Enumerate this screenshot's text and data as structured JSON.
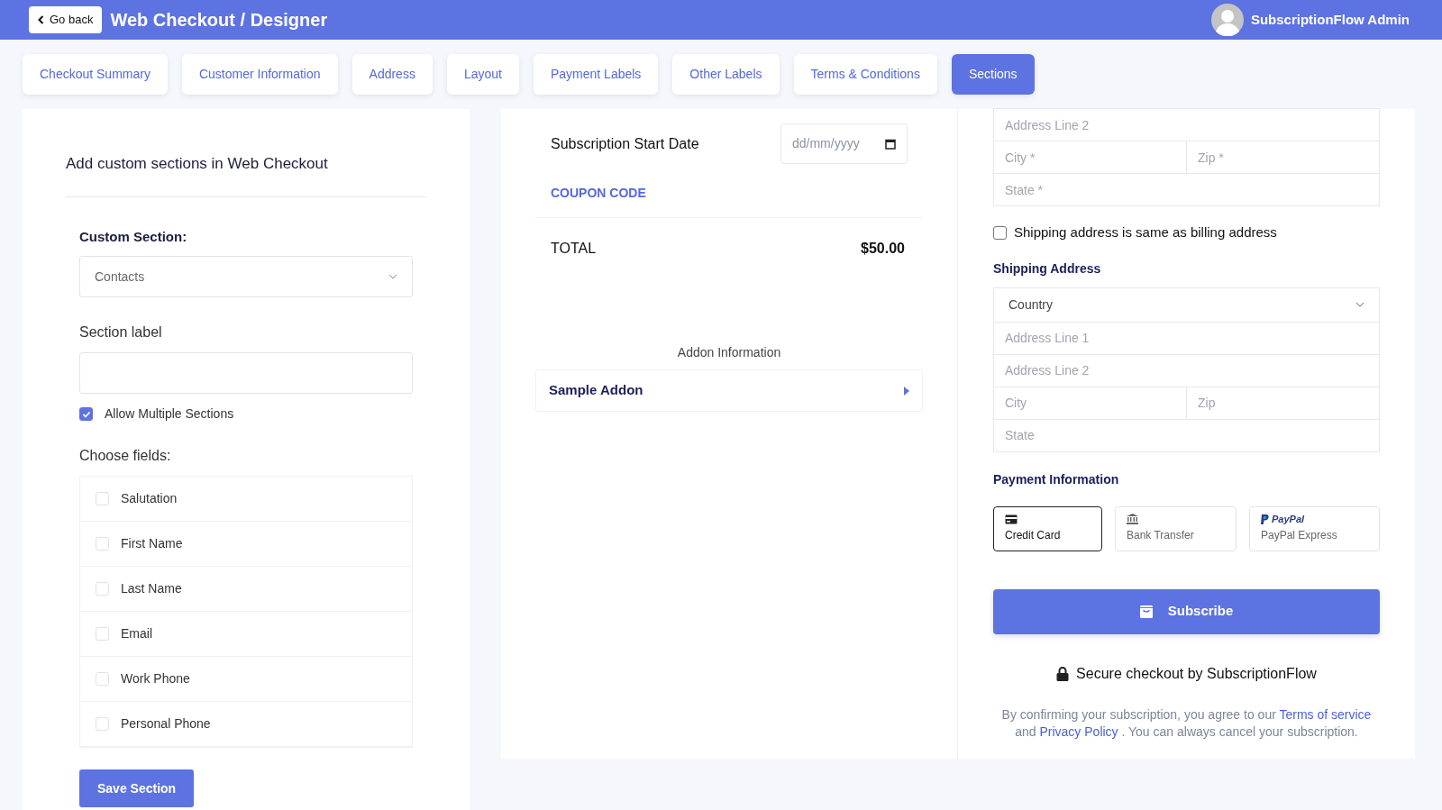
{
  "header": {
    "back_button": "Go back",
    "title": "Web Checkout / Designer",
    "user": "SubscriptionFlow Admin"
  },
  "tabs": [
    {
      "label": "Checkout Summary",
      "selected": false
    },
    {
      "label": "Customer Information",
      "selected": false
    },
    {
      "label": "Address",
      "selected": false
    },
    {
      "label": "Layout",
      "selected": false
    },
    {
      "label": "Payment Labels",
      "selected": false
    },
    {
      "label": "Other Labels",
      "selected": false
    },
    {
      "label": "Terms & Conditions",
      "selected": false
    },
    {
      "label": "Sections",
      "selected": true
    }
  ],
  "editor": {
    "heading": "Add custom sections in Web Checkout",
    "custom_section_label": "Custom Section:",
    "custom_section_value": "Contacts",
    "section_label_label": "Section label",
    "allow_multiple": {
      "label": "Allow Multiple Sections",
      "checked": true
    },
    "choose_fields_label": "Choose fields:",
    "fields": [
      {
        "label": "Salutation",
        "checked": false
      },
      {
        "label": "First Name",
        "checked": false
      },
      {
        "label": "Last Name",
        "checked": false
      },
      {
        "label": "Email",
        "checked": false
      },
      {
        "label": "Work Phone",
        "checked": false
      },
      {
        "label": "Personal Phone",
        "checked": false
      }
    ],
    "save_button": "Save Section"
  },
  "summary": {
    "start_date_label": "Subscription Start Date",
    "start_date_placeholder": "dd/mm/yyyy",
    "coupon": "COUPON CODE",
    "total_label": "TOTAL",
    "total_amount": "$50.00",
    "addon_heading": "Addon Information",
    "addons": [
      {
        "name": "Sample Addon"
      }
    ]
  },
  "billing_fields": [
    [
      {
        "placeholder": "Address Line 2"
      }
    ],
    [
      {
        "placeholder": "City *"
      },
      {
        "placeholder": "Zip *"
      }
    ],
    [
      {
        "placeholder": "State *"
      }
    ]
  ],
  "same_as_billing": {
    "label": "Shipping address is same as billing address",
    "checked": false
  },
  "shipping": {
    "heading": "Shipping Address",
    "country": "Country",
    "fields": [
      [
        {
          "placeholder": "Address Line 1"
        }
      ],
      [
        {
          "placeholder": "Address Line 2"
        }
      ],
      [
        {
          "placeholder": "City"
        },
        {
          "placeholder": "Zip"
        }
      ],
      [
        {
          "placeholder": "State"
        }
      ]
    ]
  },
  "payment": {
    "heading": "Payment Information",
    "methods": [
      {
        "kind": "card",
        "label": "Credit Card",
        "selected": true
      },
      {
        "kind": "bank",
        "label": "Bank Transfer",
        "selected": false
      },
      {
        "kind": "paypal",
        "logo_text": "PayPal",
        "label": "PayPal Express",
        "selected": false
      }
    ]
  },
  "subscribe_button": "Subscribe",
  "secure_text": "Secure checkout by SubscriptionFlow",
  "legal": [
    {
      "kind": "text",
      "text": "By confirming your subscription, you agree to our "
    },
    {
      "kind": "link",
      "text": "Terms of service"
    },
    {
      "kind": "text",
      "text": " and "
    },
    {
      "kind": "link",
      "text": "Privacy Policy"
    },
    {
      "kind": "text",
      "text": " . You can always cancel your subscription."
    }
  ]
}
